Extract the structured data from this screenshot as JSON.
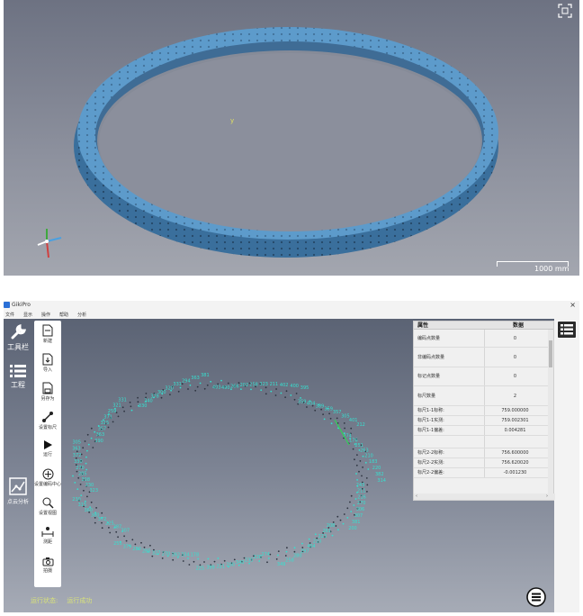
{
  "viewer": {
    "scale_label": "1000 mm",
    "axis_marker": "y"
  },
  "app": {
    "title": "GikiPro",
    "close_glyph": "×",
    "menu": [
      "文件",
      "显示",
      "操作",
      "帮助",
      "分析"
    ],
    "left_buttons": [
      {
        "label": "工具栏",
        "icon": "wrench-icon"
      },
      {
        "label": "工程",
        "icon": "list-icon"
      },
      {
        "label": "点云分析",
        "icon": "chart-icon"
      }
    ],
    "tools": [
      {
        "label": "新建",
        "icon": "file-new-icon"
      },
      {
        "label": "导入",
        "icon": "import-icon"
      },
      {
        "label": "另存为",
        "icon": "save-as-icon"
      },
      {
        "label": "设置标尺",
        "icon": "ruler-icon"
      },
      {
        "label": "运行",
        "icon": "play-icon"
      },
      {
        "label": "设置编码中心",
        "icon": "target-icon"
      },
      {
        "label": "设置视图",
        "icon": "zoom-icon"
      },
      {
        "label": "测距",
        "icon": "measure-icon"
      },
      {
        "label": "拍摄",
        "icon": "camera-icon"
      }
    ],
    "properties": {
      "header_name": "属性",
      "header_value": "数据",
      "rows": [
        {
          "name": "编码点数量",
          "value": "0"
        },
        {
          "name": "非编码点数量",
          "value": "0"
        },
        {
          "name": "标记点数量",
          "value": "0"
        },
        {
          "name": "标尺数量",
          "value": "2"
        },
        {
          "name": "标尺1-1标称:",
          "value": "759.000000"
        },
        {
          "name": "标尺1-1实测:",
          "value": "759.002301"
        },
        {
          "name": "标尺1-1偏差:",
          "value": "0.004281"
        },
        {
          "name": "标尺2-2标称:",
          "value": "756.600000"
        },
        {
          "name": "标尺2-2实测:",
          "value": "756.620020"
        },
        {
          "name": "标尺2-2偏差:",
          "value": "-0.001230"
        }
      ]
    },
    "status": {
      "label": "运行状态:",
      "value": "运行成功"
    },
    "point_labels": [
      "490",
      "266",
      "202",
      "258",
      "323",
      "211",
      "402",
      "400",
      "395",
      "359",
      "404",
      "389",
      "359",
      "357",
      "305",
      "401",
      "212",
      "274",
      "176",
      "251",
      "263",
      "210",
      "183",
      "220",
      "382",
      "314",
      "243",
      "211",
      "216",
      "270",
      "306",
      "307",
      "381",
      "200",
      "208",
      "261",
      "223",
      "210",
      "404",
      "297",
      "280",
      "258",
      "349",
      "274",
      "228",
      "235",
      "340",
      "200",
      "221",
      "399",
      "225",
      "178",
      "334",
      "392",
      "270",
      "327",
      "285",
      "280",
      "379",
      "255",
      "307",
      "287",
      "225",
      "372",
      "380",
      "360",
      "315",
      "230",
      "323",
      "230",
      "308",
      "285",
      "270",
      "330",
      "372",
      "363",
      "305",
      "390",
      "363",
      "357",
      "315",
      "371",
      "259",
      "321",
      "331",
      "330",
      "240",
      "378",
      "300",
      "320",
      "331",
      "294",
      "363",
      "381",
      "403"
    ],
    "colors": {
      "accent_points": "#36e0d0",
      "ruler_highlight": "#32d25a",
      "ring": "#4f8dc0"
    }
  }
}
